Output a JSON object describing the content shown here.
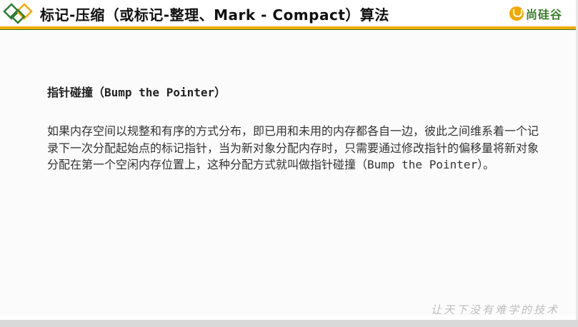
{
  "header": {
    "title": "标记-压缩（或标记-整理、Mark - Compact）算法",
    "brand": "尚硅谷"
  },
  "content": {
    "subheading": "指针碰撞（Bump the Pointer）",
    "paragraph": "如果内存空间以规整和有序的方式分布，即已用和未用的内存都各自一边，彼此之间维系着一个记录下一次分配起始点的标记指针，当为新对象分配内存时，只需要通过修改指针的偏移量将新对象分配在第一个空闲内存位置上，这种分配方式就叫做指针碰撞（Bump the Pointer）。"
  },
  "footer": {
    "watermark": "让天下没有难学的技术"
  },
  "colors": {
    "accent_orange": "#f2a900",
    "accent_green": "#2e7d32",
    "brand_green": "#3a7d2b"
  }
}
